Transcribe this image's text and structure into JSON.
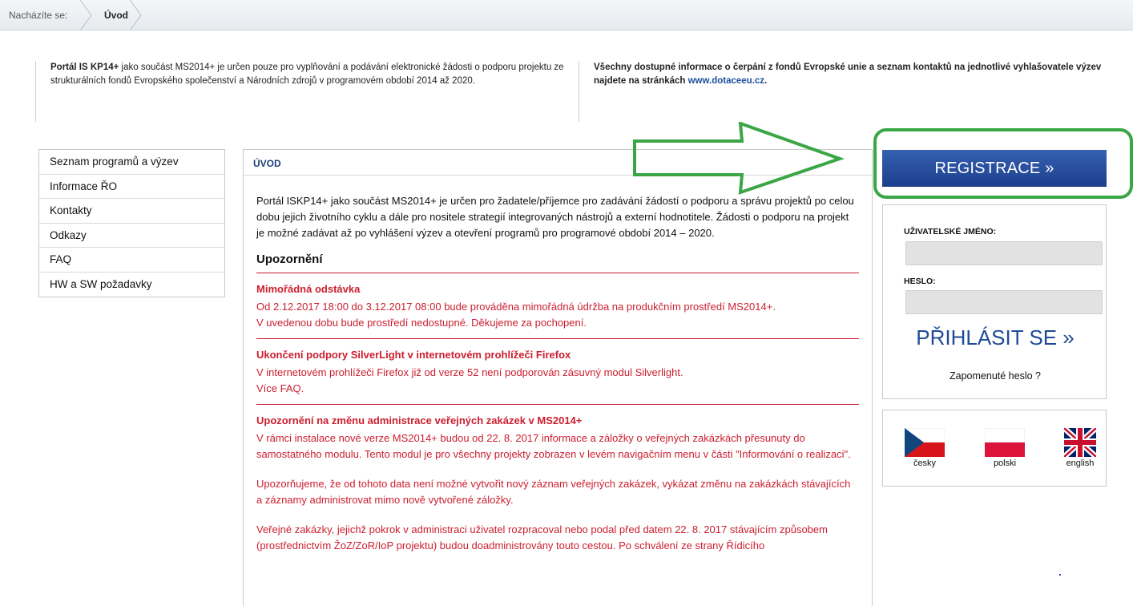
{
  "breadcrumb": {
    "label": "Nacházíte se:",
    "current": "Úvod"
  },
  "intro": {
    "left_bold": "Portál IS KP14+",
    "left_text": " jako součást MS2014+ je určen pouze pro vyplňování a podávání elektronické žádosti o podporu projektu ze strukturálních fondů Evropského společenství a Národních zdrojů v programovém období 2014 až 2020.",
    "right_text": "Všechny dostupné informace o čerpání z fondů Evropské unie a seznam kontaktů na jednotlivé vyhlašovatele výzev najdete na stránkách ",
    "right_link": "www.dotaceeu.cz",
    "right_end": "."
  },
  "sidebar": {
    "items": [
      {
        "label": "Seznam programů a výzev"
      },
      {
        "label": "Informace ŘO"
      },
      {
        "label": "Kontakty"
      },
      {
        "label": "Odkazy"
      },
      {
        "label": "FAQ"
      },
      {
        "label": "HW a SW požadavky"
      }
    ]
  },
  "main": {
    "header": "ÚVOD",
    "intro": "Portál ISKP14+ jako součást MS2014+ je určen pro žadatele/příjemce pro zadávání žádostí o podporu a správu projektů po celou dobu jejich životního cyklu a dále pro nositele strategií integrovaných nástrojů a externí hodnotitele. Žádosti o podporu na projekt je možné zadávat až po vyhlášení výzev a otevření programů pro programové období 2014 – 2020.",
    "warning_heading": "Upozornění",
    "notices": [
      {
        "title": "Mimořádná odstávka",
        "body1": "Od 2.12.2017 18:00 do 3.12.2017 08:00 bude prováděna mimořádná údržba na produkčním prostředí MS2014+.",
        "body2": "V uvedenou dobu bude prostředí nedostupné. Děkujeme za pochopení."
      },
      {
        "title": "Ukončení podpory SilverLight v internetovém prohlížeči Firefox",
        "body1": "V internetovém prohlížeči Firefox již od verze 52 není podporován zásuvný modul Silverlight.",
        "body2": "Více FAQ."
      },
      {
        "title": "Upozornění na změnu administrace veřejných zakázek v MS2014+",
        "body1": "V rámci instalace nové verze MS2014+ budou od 22. 8. 2017 informace a záložky o veřejných zakázkách přesunuty do samostatného modulu. Tento modul je pro všechny projekty zobrazen v levém navigačním menu v části \"Informování o realizaci\".",
        "body2": ""
      }
    ],
    "para2": "Upozorňujeme, že od tohoto data není možné vytvořit nový záznam veřejných zakázek, vykázat změnu na zakázkách stávajících a záznamy administrovat mimo nově vytvořené záložky.",
    "para3": "Veřejné zakázky, jejichž pokrok v administraci uživatel rozpracoval nebo podal před datem 22. 8. 2017 stávajícím způsobem (prostřednictvím ŽoZ/ZoR/IoP projektu) budou doadministrovány touto cestou. Po schválení ze strany Řídicího"
  },
  "registration": {
    "label": "REGISTRACE »"
  },
  "login": {
    "username_label": "UŽIVATELSKÉ JMÉNO:",
    "username_value": "",
    "password_label": "HESLO:",
    "password_value": "",
    "submit_label": "PŘIHLÁSIT SE »",
    "forgot_label": "Zapomenuté heslo ?"
  },
  "languages": [
    {
      "label": "česky",
      "icon": "czech-flag-icon"
    },
    {
      "label": "polski",
      "icon": "polish-flag-icon"
    },
    {
      "label": "english",
      "icon": "uk-flag-icon"
    }
  ],
  "colors": {
    "accent": "#1f4b96",
    "warning": "#cc1e2f",
    "highlight": "#3aa645"
  }
}
